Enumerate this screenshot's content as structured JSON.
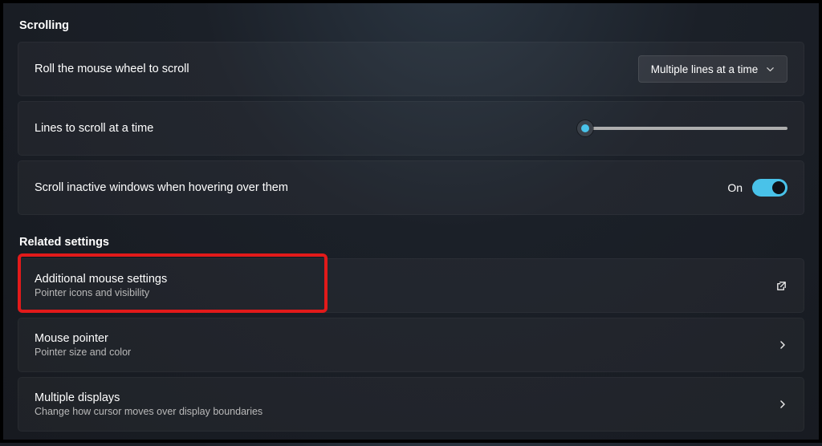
{
  "sections": {
    "scrolling": {
      "title": "Scrolling",
      "rows": {
        "roll": {
          "label": "Roll the mouse wheel to scroll",
          "dropdown_value": "Multiple lines at a time"
        },
        "lines": {
          "label": "Lines to scroll at a time",
          "slider_percent": 5
        },
        "inactive": {
          "label": "Scroll inactive windows when hovering over them",
          "toggle_label": "On",
          "toggle_on": true
        }
      }
    },
    "related": {
      "title": "Related settings",
      "items": [
        {
          "title": "Additional mouse settings",
          "sub": "Pointer icons and visibility",
          "action": "popout"
        },
        {
          "title": "Mouse pointer",
          "sub": "Pointer size and color",
          "action": "nav"
        },
        {
          "title": "Multiple displays",
          "sub": "Change how cursor moves over display boundaries",
          "action": "nav"
        }
      ]
    }
  }
}
